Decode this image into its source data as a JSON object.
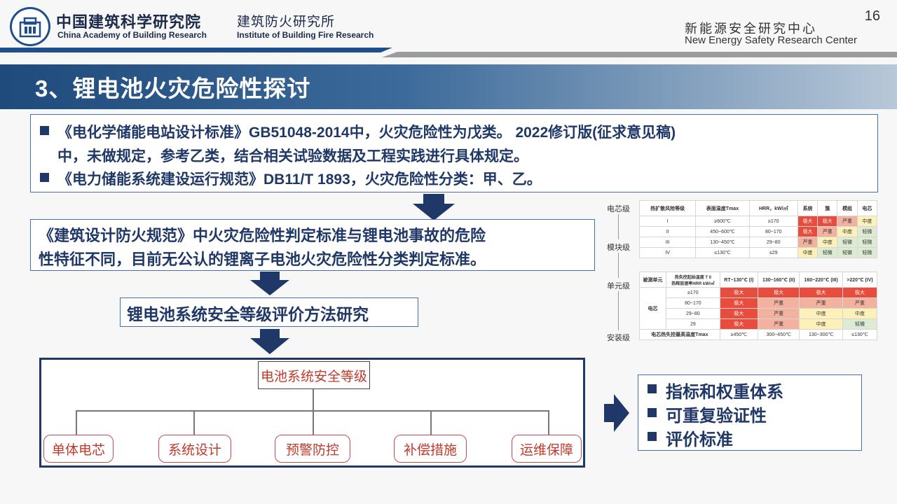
{
  "header": {
    "org_cn": "中国建筑科学研究院",
    "org_en": "China Academy of Building Research",
    "inst_cn": "建筑防火研究所",
    "inst_en": "Institute of Building Fire Research",
    "center_cn": "新能源安全研究中心",
    "center_en": "New Energy Safety Research Center",
    "page_number": "16"
  },
  "title": "3、锂电池火灾危险性探讨",
  "top_box": {
    "line1": "《电化学储能电站设计标准》GB51048-2014中，火灾危险性为戊类。  2022修订版(征求意见稿)",
    "line2": "中，未做规定，参考乙类，结合相关试验数据及工程实践进行具体规定。",
    "line3": "《电力储能系统建设运行规范》DB11/T 1893，火灾危险性分类：甲、乙。"
  },
  "mid_box": {
    "line1": "《建筑设计防火规范》中火灾危险性判定标准与锂电池事故的危险",
    "line2": "性特征不同，目前无公认的锂离子电池火灾危险性分类判定标准。"
  },
  "eval_box": "锂电池系统安全等级评价方法研究",
  "tree": {
    "root": "电池系统安全等级",
    "children": [
      "单体电芯",
      "系统设计",
      "预警防控",
      "补偿措施",
      "运维保障"
    ]
  },
  "side_labels": [
    "电芯级",
    "模块级",
    "单元级",
    "安装级"
  ],
  "table1": {
    "headers": [
      "热扩散风险等级",
      "表面温度Tmax",
      "HRR，kW/㎡",
      "系统",
      "簇",
      "模组",
      "电芯"
    ],
    "rows": [
      [
        "I",
        "≥600℃",
        "≥170",
        "极大",
        "极大",
        "严重",
        "中度"
      ],
      [
        "II",
        "450~600℃",
        "80~170",
        "极大",
        "严重",
        "中度",
        "轻微"
      ],
      [
        "III",
        "130~450℃",
        "29~80",
        "严重",
        "中度",
        "轻微",
        "轻微"
      ],
      [
        "IV",
        "≤130℃",
        "≤29",
        "中度",
        "轻微",
        "轻微",
        "轻微"
      ]
    ]
  },
  "table2": {
    "corner1": "被测单元",
    "corner2": "热失控起始温度 T 0",
    "corner3": "热释放速率HRR kW/㎡",
    "headers": [
      "RT~130℃ (I)",
      "130~160℃ (II)",
      "160~220℃ (III)",
      ">220℃ (IV)"
    ],
    "row_label": "电芯",
    "rows": [
      [
        "≥170",
        "极大",
        "极大",
        "极大",
        "极大"
      ],
      [
        "80~170",
        "极大",
        "严重",
        "严重",
        "严重"
      ],
      [
        "29~80",
        "极大",
        "严重",
        "中度",
        "中度"
      ],
      [
        "29",
        "极大",
        "严重",
        "中度",
        "轻微"
      ]
    ],
    "footer_label": "电芯热失控最高温度Tmax",
    "footer": [
      "≥450℃",
      "300~450℃",
      "130~300℃",
      "≤130℃"
    ]
  },
  "right_box": [
    "指标和权重体系",
    "可重复验证性",
    "评价标准"
  ],
  "colors": {
    "navy": "#1f3868",
    "accent_red": "#c0392b",
    "risk_extreme": "#e74c3c",
    "risk_serious": "#f3b1a0",
    "risk_moderate": "#fdf0b9",
    "risk_slight": "#dcebd2"
  }
}
